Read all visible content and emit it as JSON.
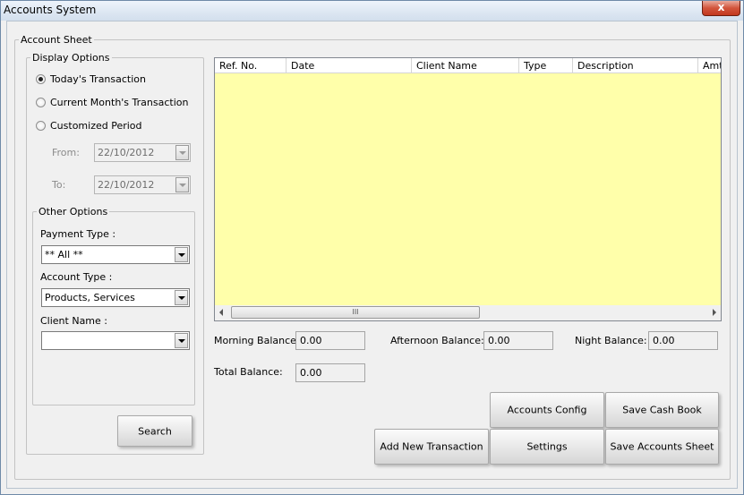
{
  "window": {
    "title": "Accounts System",
    "close_glyph": "x"
  },
  "account_sheet": {
    "legend": "Account Sheet"
  },
  "display_options": {
    "legend": "Display Options",
    "radios": [
      {
        "label": "Today's Transaction",
        "selected": true
      },
      {
        "label": "Current Month's Transaction",
        "selected": false
      },
      {
        "label": "Customized Period",
        "selected": false
      }
    ],
    "from_label": "From:",
    "from_value": "22/10/2012",
    "to_label": "To:",
    "to_value": "22/10/2012"
  },
  "other_options": {
    "legend": "Other Options",
    "payment_type_label": "Payment Type :",
    "payment_type_value": "** All **",
    "account_type_label": "Account Type :",
    "account_type_value": "Products, Services",
    "client_name_label": "Client Name :",
    "client_name_value": ""
  },
  "search_button": "Search",
  "grid": {
    "columns": [
      "Ref. No.",
      "Date",
      "Client Name",
      "Type",
      "Description",
      "Amt"
    ],
    "background": "#ffffaa",
    "scroll_grip": "III"
  },
  "balances": {
    "morning_label": "Morning Balance:",
    "morning_value": "0.00",
    "afternoon_label": "Afternoon Balance:",
    "afternoon_value": "0.00",
    "night_label": "Night Balance:",
    "night_value": "0.00",
    "total_label": "Total Balance:",
    "total_value": "0.00"
  },
  "actions": {
    "accounts_config": "Accounts Config",
    "save_cash_book": "Save Cash Book",
    "add_new_transaction": "Add New Transaction",
    "settings": "Settings",
    "save_accounts_sheet": "Save Accounts Sheet"
  }
}
